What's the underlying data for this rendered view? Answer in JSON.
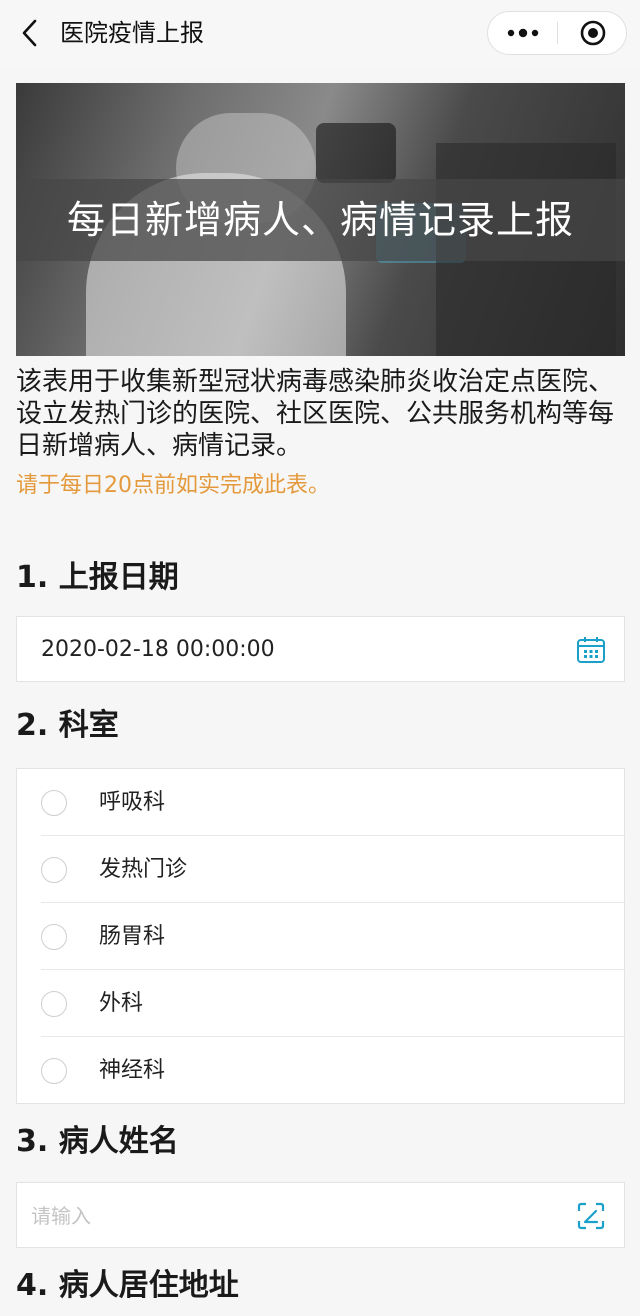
{
  "nav": {
    "title": "医院疫情上报",
    "back_icon": "chevron-left-icon",
    "more_icon": "more-dots-icon",
    "close_icon": "target-close-icon"
  },
  "banner": {
    "title": "每日新增病人、病情记录上报"
  },
  "description": "该表用于收集新型冠状病毒感染肺炎收治定点医院、设立发热门诊的医院、社区医院、公共服务机构等每日新增病人、病情记录。",
  "notice": "请于每日20点前如实完成此表。",
  "notice_color": "#e49a3c",
  "accent_color": "#1aa0c9",
  "questions": {
    "q1": {
      "title": "1. 上报日期",
      "value": "2020-02-18 00:00:00",
      "icon": "calendar-icon"
    },
    "q2": {
      "title": "2. 科室",
      "options": [
        "呼吸科",
        "发热门诊",
        "肠胃科",
        "外科",
        "神经科"
      ]
    },
    "q3": {
      "title": "3. 病人姓名",
      "placeholder": "请输入",
      "icon": "scan-input-icon"
    },
    "q4": {
      "title": "4. 病人居住地址"
    }
  }
}
